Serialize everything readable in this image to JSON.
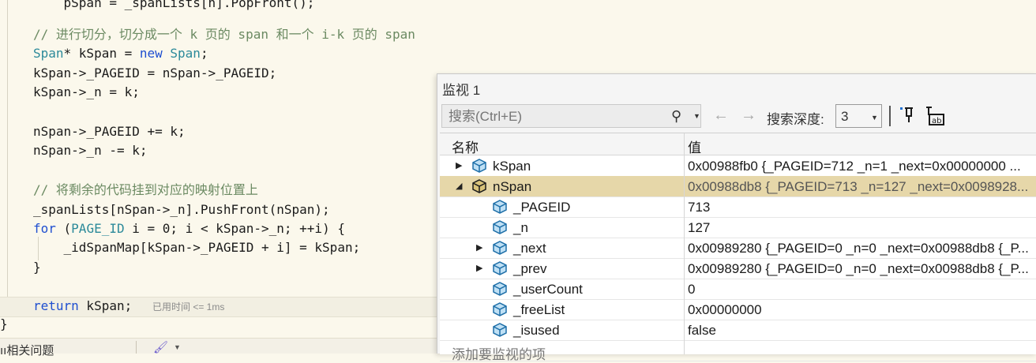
{
  "editor": {
    "comment1": "// 进行切分，切分成一个 k 页的 span 和一个 i-k 页的 span",
    "comment2": "// 将剩余的代码挂到对应的映射位置上",
    "elapsed_hint": "已用时间 <= 1ms"
  },
  "bottom_bar": {
    "label": "ıı相关问题"
  },
  "watch": {
    "title": "监视 1",
    "search_placeholder": "搜索(Ctrl+E)",
    "depth_label": "搜索深度:",
    "depth_value": "3",
    "columns": {
      "name": "名称",
      "value": "值"
    },
    "rows": [
      {
        "name": "kSpan",
        "value": "0x00988fb0 {_PAGEID=712 _n=1 _next=0x00000000 ..."
      },
      {
        "name": "nSpan",
        "value": "0x00988db8 {_PAGEID=713 _n=127 _next=0x0098928..."
      },
      {
        "name": "_PAGEID",
        "value": "713"
      },
      {
        "name": "_n",
        "value": "127"
      },
      {
        "name": "_next",
        "value": "0x00989280 {_PAGEID=0 _n=0 _next=0x00988db8 {_P..."
      },
      {
        "name": "_prev",
        "value": "0x00989280 {_PAGEID=0 _n=0 _next=0x00988db8 {_P..."
      },
      {
        "name": "_userCount",
        "value": "0"
      },
      {
        "name": "_freeList",
        "value": "0x00000000"
      },
      {
        "name": "_isused",
        "value": "false"
      }
    ],
    "add_item_placeholder": "添加要监视的项"
  },
  "colors": {
    "keyword": "#1f4fd0",
    "type": "#2c8a9a",
    "comment": "#6b8a62",
    "selection": "#e6d7a9"
  },
  "icons": [
    "search-icon",
    "back-arrow-icon",
    "forward-arrow-icon",
    "pin-icon",
    "value-format-icon",
    "object-icon",
    "brush-icon"
  ]
}
